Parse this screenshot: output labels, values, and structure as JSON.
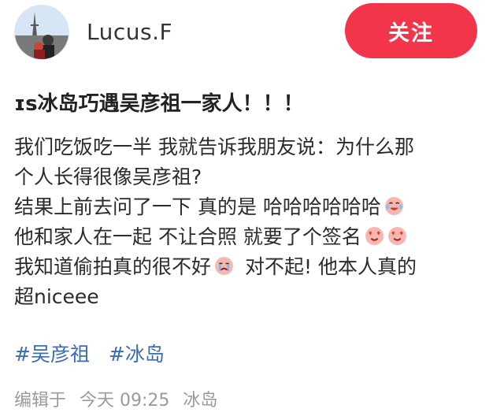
{
  "header": {
    "username": "Lucus.F",
    "follow_label": "关注"
  },
  "post": {
    "title": "ɪs冰岛巧遇吴彦祖一家人！！！",
    "lines": [
      "我们吃饭吃一半 我就告诉我朋友说：为什么那",
      "个人长得很像吴彦祖?",
      "结果上前去问了一下 真的是 哈哈哈哈哈哈",
      "他和家人在一起 不让合照 就要了个签名",
      "我知道偷拍真的很不好",
      "对不起! 他本人真的",
      "超niceee"
    ],
    "emojis": {
      "laugh": "laugh-crying-face-icon",
      "heart_eyes": "heart-eyes-face-icon",
      "crying": "crying-face-icon"
    },
    "tags": [
      "#吴彦祖",
      "#冰岛"
    ]
  },
  "footer": {
    "edited": "编辑于",
    "time": "今天 09:25",
    "location": "冰岛"
  },
  "colors": {
    "follow_bg": "#f2354a",
    "tag": "#3b6cb4",
    "meta": "#9a9a9a"
  }
}
